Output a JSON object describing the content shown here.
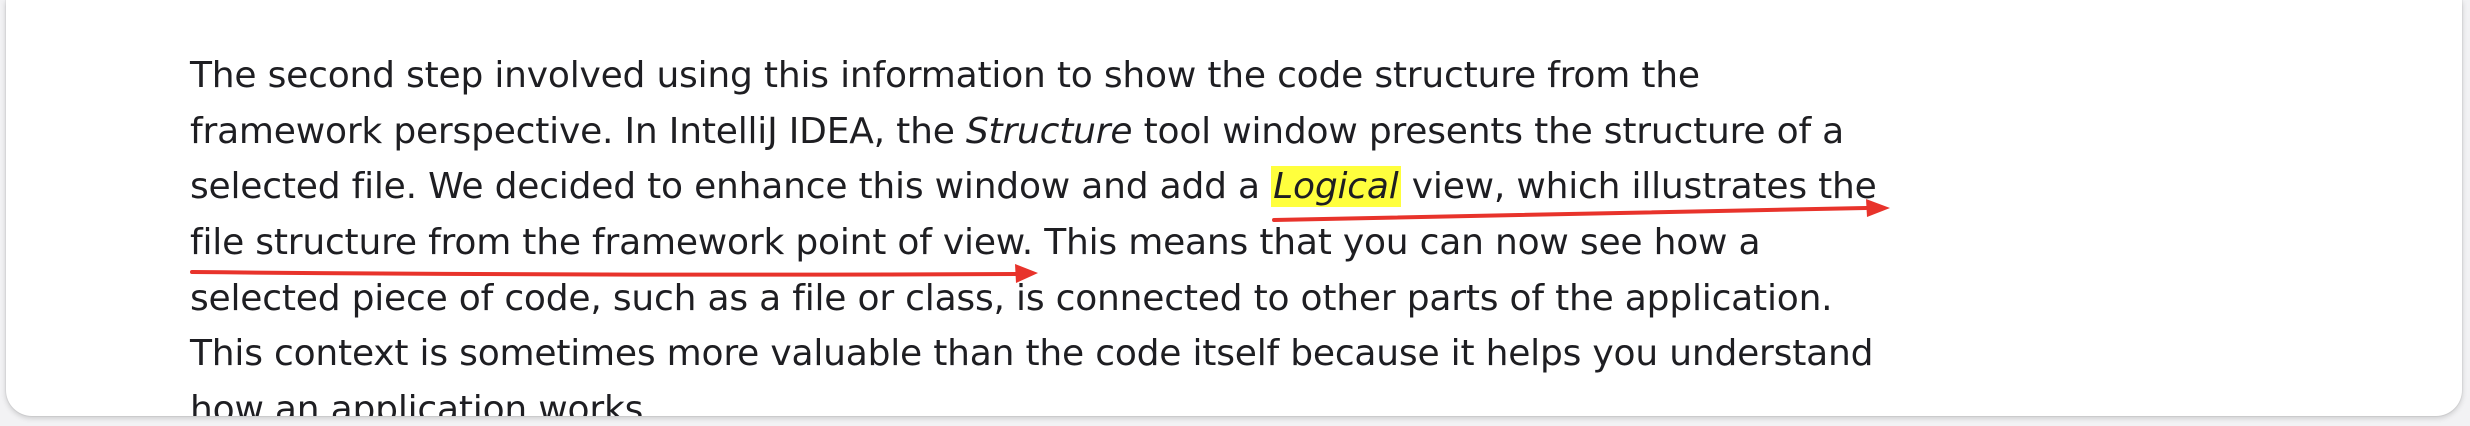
{
  "lines": [
    {
      "parts": [
        "The second step involved using this information to show the code structure from the"
      ]
    },
    {
      "parts": [
        "framework perspective. In IntelliJ IDEA, the ",
        "Structure",
        " tool window presents the structure of a"
      ]
    },
    {
      "parts": [
        "selected file. We decided to enhance this window and add a ",
        "Logical",
        " view, which illustrates the"
      ]
    },
    {
      "parts": [
        "file structure from the framework point of view. This means that you can now see how a"
      ]
    },
    {
      "parts": [
        "selected piece of code, such as a file or class, is connected to other parts of the application."
      ]
    },
    {
      "parts": [
        "This context is sometimes more valuable than the code itself because it helps you understand"
      ]
    },
    {
      "parts": [
        "how an application works."
      ]
    }
  ],
  "colors": {
    "highlight": "#ffff3d",
    "arrow": "#e8332b",
    "text": "#1e1e22"
  }
}
